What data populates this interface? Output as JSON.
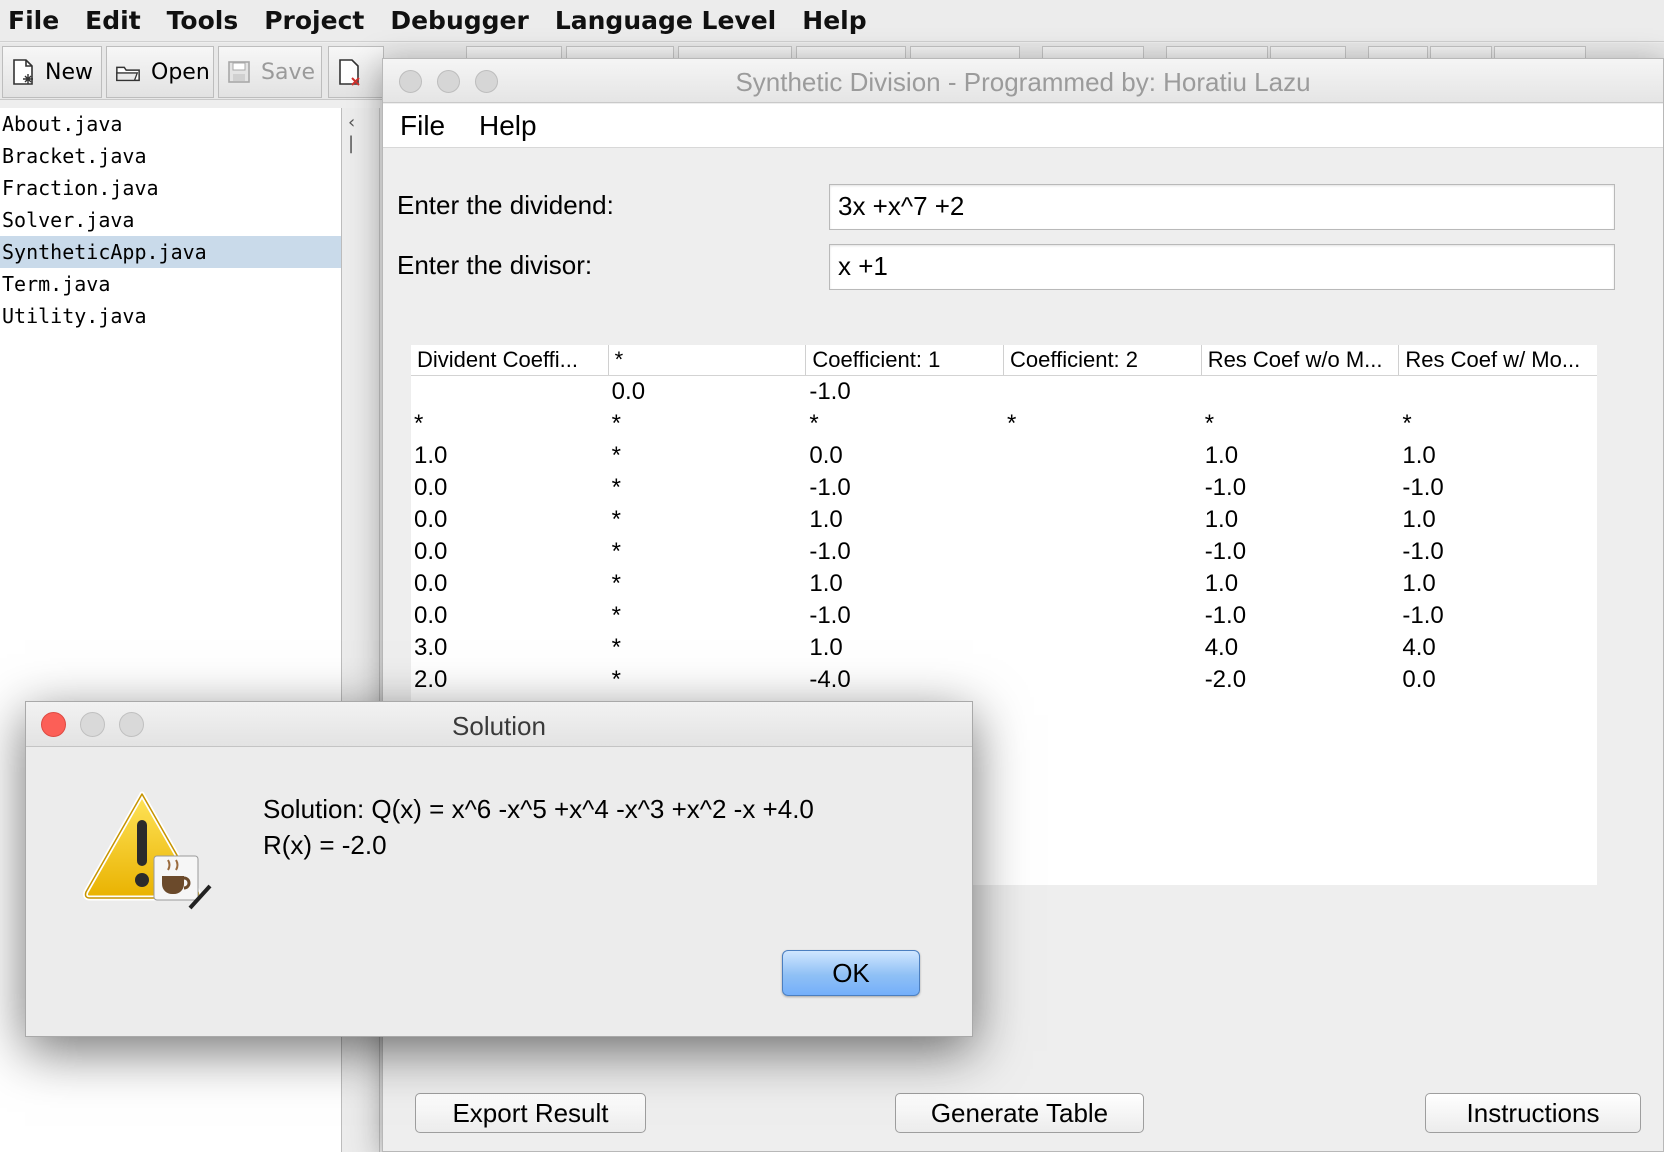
{
  "ide": {
    "menu": [
      "File",
      "Edit",
      "Tools",
      "Project",
      "Debugger",
      "Language Level",
      "Help"
    ],
    "toolbar": {
      "new_label": "New",
      "open_label": "Open",
      "save_label": "Save"
    },
    "files": [
      "About.java",
      "Bracket.java",
      "Fraction.java",
      "Solver.java",
      "SyntheticApp.java",
      "Term.java",
      "Utility.java"
    ],
    "selected_file": "SyntheticApp.java"
  },
  "app": {
    "title": "Synthetic Division - Programmed by: Horatiu Lazu",
    "menu": [
      "File",
      "Help"
    ],
    "dividend_label": "Enter the dividend:",
    "dividend_value": "3x +x^7 +2",
    "divisor_label": "Enter the divisor:",
    "divisor_value": "x +1",
    "table": {
      "headers": [
        "Divident Coeffi...",
        "*",
        "Coefficient: 1",
        "Coefficient: 2",
        "Res Coef w/o M...",
        "Res Coef w/ Mo..."
      ],
      "rows": [
        [
          "",
          "0.0",
          "-1.0",
          "",
          "",
          ""
        ],
        [
          "*",
          "*",
          "*",
          "*",
          "*",
          "*"
        ],
        [
          "1.0",
          "*",
          "0.0",
          "",
          "1.0",
          "1.0"
        ],
        [
          "0.0",
          "*",
          "-1.0",
          "",
          "-1.0",
          "-1.0"
        ],
        [
          "0.0",
          "*",
          "1.0",
          "",
          "1.0",
          "1.0"
        ],
        [
          "0.0",
          "*",
          "-1.0",
          "",
          "-1.0",
          "-1.0"
        ],
        [
          "0.0",
          "*",
          "1.0",
          "",
          "1.0",
          "1.0"
        ],
        [
          "0.0",
          "*",
          "-1.0",
          "",
          "-1.0",
          "-1.0"
        ],
        [
          "3.0",
          "*",
          "1.0",
          "",
          "4.0",
          "4.0"
        ],
        [
          "2.0",
          "*",
          "-4.0",
          "",
          "-2.0",
          "0.0"
        ]
      ]
    },
    "buttons": {
      "export": "Export Result",
      "generate": "Generate Table",
      "instructions": "Instructions"
    }
  },
  "dialog": {
    "title": "Solution",
    "message_line1": "Solution: Q(x) = x^6 -x^5 +x^4 -x^3 +x^2 -x +4.0",
    "message_line2": "R(x) = -2.0",
    "ok_label": "OK",
    "icon": "warning-icon"
  },
  "colors": {
    "selection": "#c9daea",
    "ok_button": "#8fc0f5",
    "close_red": "#fc5f57"
  }
}
